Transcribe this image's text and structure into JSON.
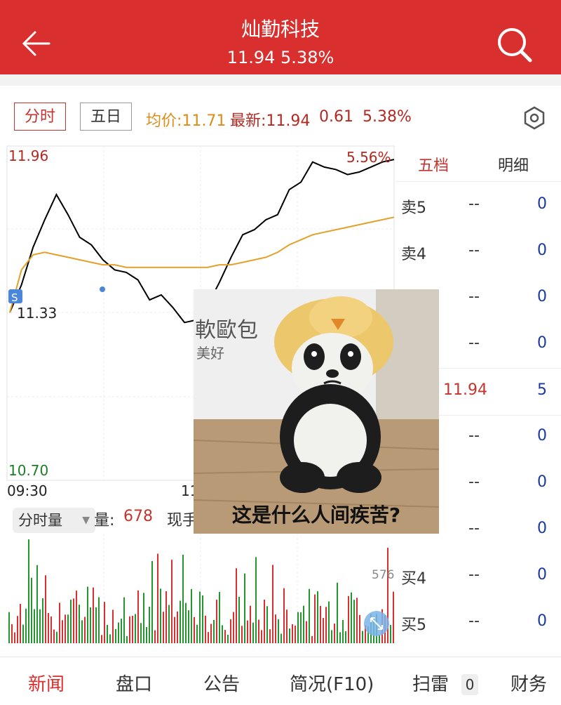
{
  "header": {
    "title": "灿勤科技",
    "subtitle": "11.94 5.38%"
  },
  "tabs": {
    "intraday": "分时",
    "five_day": "五日"
  },
  "quote": {
    "avg_price": "均价:11.71",
    "latest": "最新:11.94",
    "change": "0.61",
    "change_pct": "5.38%"
  },
  "chart": {
    "high_label": "11.96",
    "low_label": "10.70",
    "prev_label": "11.33",
    "pct_label": "5.56%",
    "time_start": "09:30",
    "time_mid": "11",
    "marker": "S",
    "vol_side_label": "576",
    "line_color": "#000000",
    "avg_color": "#e3a02a",
    "up_color": "#d9302f",
    "down_color": "#23962e"
  },
  "chart_data": {
    "type": "line",
    "title": "",
    "xlabel": "",
    "ylabel": "",
    "x_ticks": [
      "09:30",
      "11"
    ],
    "ylim": [
      10.7,
      11.96
    ],
    "series": [
      {
        "values": [
          11.33,
          11.44,
          11.59,
          11.7,
          11.8,
          11.72,
          11.63,
          11.6,
          11.54,
          11.5,
          11.49,
          11.46,
          11.38,
          11.4,
          11.35,
          11.29,
          11.3,
          11.36,
          11.45,
          11.55,
          11.64,
          11.66,
          11.7,
          11.72,
          11.82,
          11.85,
          11.93,
          11.91,
          11.9,
          11.88,
          11.89,
          11.91,
          11.93,
          11.94
        ]
      },
      {
        "values": [
          11.33,
          11.5,
          11.56,
          11.57,
          11.56,
          11.55,
          11.54,
          11.53,
          11.52,
          11.52,
          11.51,
          11.51,
          11.51,
          11.51,
          11.51,
          11.51,
          11.51,
          11.51,
          11.52,
          11.52,
          11.53,
          11.54,
          11.55,
          11.57,
          11.6,
          11.62,
          11.64,
          11.65,
          11.66,
          11.67,
          11.68,
          11.69,
          11.7,
          11.71
        ]
      }
    ]
  },
  "order_panel": {
    "tab_five": "五档",
    "tab_detail": "明细",
    "rows": [
      {
        "label": "卖5",
        "price": "--",
        "vol": "0"
      },
      {
        "label": "卖4",
        "price": "--",
        "vol": "0"
      },
      {
        "label": "",
        "price": "--",
        "vol": "0"
      },
      {
        "label": "",
        "price": "--",
        "vol": "0"
      },
      {
        "label": "",
        "price": "11.94",
        "vol": "5"
      },
      {
        "label": "",
        "price": "--",
        "vol": "0"
      },
      {
        "label": "",
        "price": "--",
        "vol": "0"
      },
      {
        "label": "",
        "price": "--",
        "vol": "0"
      },
      {
        "label": "买4",
        "price": "--",
        "vol": "0"
      },
      {
        "label": "买5",
        "price": "--",
        "vol": "0"
      }
    ]
  },
  "volume": {
    "selector": "分时量",
    "label": "量:",
    "value": "678",
    "current": "现手"
  },
  "sticker": {
    "caption": "这是什么人间疾苦?",
    "bg_text1": "軟歐包",
    "bg_text2": "美好"
  },
  "bottom_nav": {
    "items": [
      "新闻",
      "盘口",
      "公告",
      "简况(F10)",
      "扫雷",
      "财务"
    ],
    "badge": "0"
  }
}
